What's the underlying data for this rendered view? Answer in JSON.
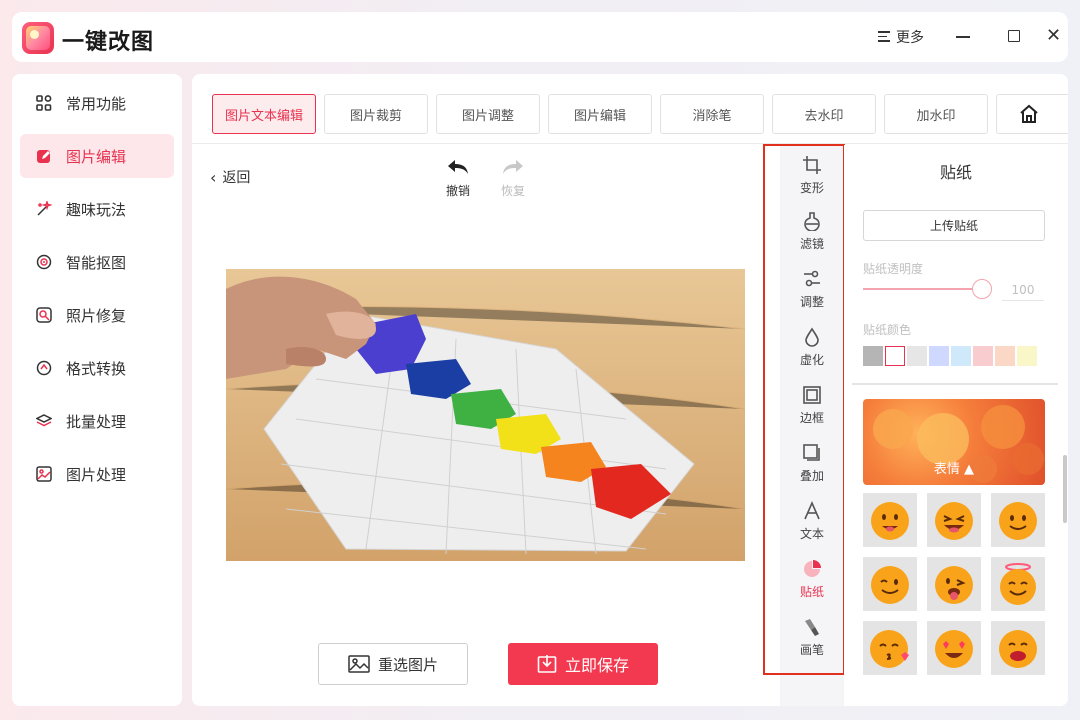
{
  "app": {
    "title": "一键改图",
    "more_label": "更多"
  },
  "sidebar": {
    "items": [
      {
        "label": "常用功能",
        "icon": "grid-icon",
        "active": false
      },
      {
        "label": "图片编辑",
        "icon": "edit-icon",
        "active": true
      },
      {
        "label": "趣味玩法",
        "icon": "magic-icon",
        "active": false
      },
      {
        "label": "智能抠图",
        "icon": "target-icon",
        "active": false
      },
      {
        "label": "照片修复",
        "icon": "repair-icon",
        "active": false
      },
      {
        "label": "格式转换",
        "icon": "convert-icon",
        "active": false
      },
      {
        "label": "批量处理",
        "icon": "layers-icon",
        "active": false
      },
      {
        "label": "图片处理",
        "icon": "image-icon",
        "active": false
      }
    ]
  },
  "tabs": [
    {
      "label": "图片文本编辑",
      "active": true
    },
    {
      "label": "图片裁剪",
      "active": false
    },
    {
      "label": "图片调整",
      "active": false
    },
    {
      "label": "图片编辑",
      "active": false
    },
    {
      "label": "消除笔",
      "active": false
    },
    {
      "label": "去水印",
      "active": false
    },
    {
      "label": "加水印",
      "active": false
    }
  ],
  "editor": {
    "back_label": "返回",
    "undo_label": "撤销",
    "redo_label": "恢复",
    "reselect_label": "重选图片",
    "save_label": "立即保存"
  },
  "tools": [
    {
      "label": "变形",
      "icon": "crop-icon",
      "active": false
    },
    {
      "label": "滤镜",
      "icon": "filter-icon",
      "active": false
    },
    {
      "label": "调整",
      "icon": "adjust-icon",
      "active": false
    },
    {
      "label": "虚化",
      "icon": "blur-drop-icon",
      "active": false
    },
    {
      "label": "边框",
      "icon": "frame-icon",
      "active": false
    },
    {
      "label": "叠加",
      "icon": "overlay-icon",
      "active": false
    },
    {
      "label": "文本",
      "icon": "text-icon",
      "active": false
    },
    {
      "label": "贴纸",
      "icon": "sticker-icon",
      "active": true
    },
    {
      "label": "画笔",
      "icon": "brush-icon",
      "active": false
    }
  ],
  "sticker_panel": {
    "title": "贴纸",
    "upload_label": "上传贴纸",
    "opacity_label": "贴纸透明度",
    "opacity_value": "100",
    "color_label": "贴纸颜色",
    "colors": [
      "#b5b5b5",
      "#ffffff",
      "#e6e6e6",
      "#cfd8ff",
      "#cfe9fb",
      "#f9cdd0",
      "#fbd8c6",
      "#f9f7c7"
    ],
    "selected_color_index": 1,
    "category_label": "表情 ▲"
  },
  "colors": {
    "accent": "#e8324f",
    "save": "#f3394f",
    "highlight_border": "#e0301e"
  }
}
